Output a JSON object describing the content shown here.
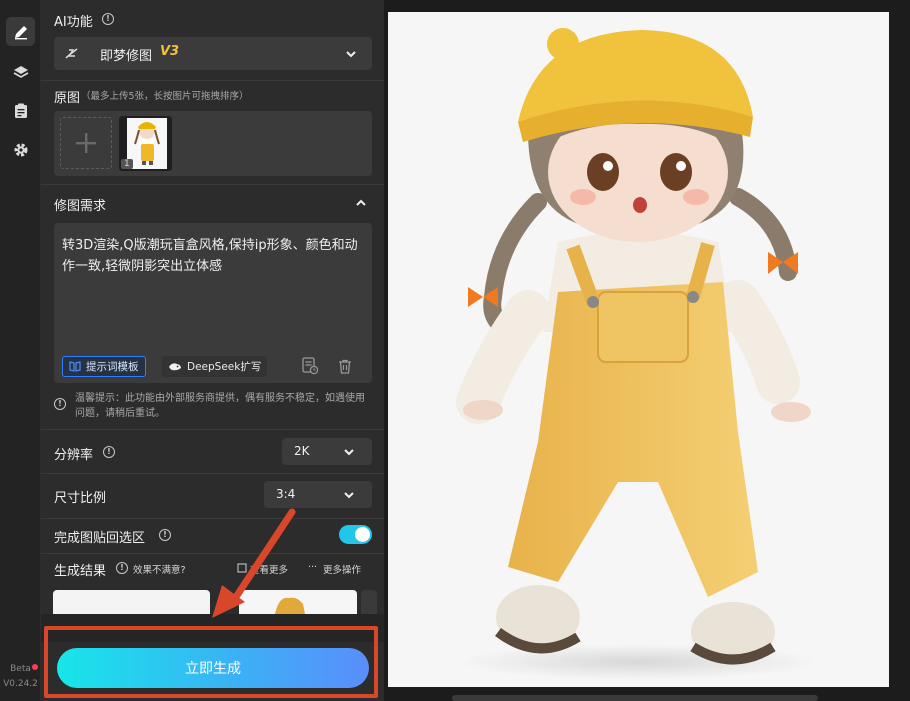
{
  "sidebar": {
    "items": [
      {
        "name": "edit",
        "icon": "pencil-icon",
        "active": true
      },
      {
        "name": "layers",
        "icon": "layers-icon",
        "active": false
      },
      {
        "name": "clipboard",
        "icon": "clipboard-icon",
        "active": false
      },
      {
        "name": "settings",
        "icon": "gear-icon",
        "active": false
      }
    ],
    "beta_label": "Beta",
    "version": "V0.24.2"
  },
  "panel": {
    "ai_function": {
      "label": "AI功能",
      "model_name": "即梦修图",
      "model_version": "V3"
    },
    "source": {
      "label": "原图",
      "hint": "（最多上传5张，长按图片可拖拽排序）",
      "thumb_index": "1"
    },
    "prompt": {
      "label": "修图需求",
      "text": "转3D渲染,Q版潮玩盲盒风格,保持ip形象、颜色和动作一致,轻微阴影突出立体感",
      "template_button": "提示词模板",
      "deepseek_button": "DeepSeek扩写"
    },
    "notice": "温馨提示：此功能由外部服务商提供，偶有服务不稳定，如遇使用问题，请稍后重试。",
    "resolution": {
      "label": "分辨率",
      "value": "2K"
    },
    "ratio": {
      "label": "尺寸比例",
      "value": "3:4"
    },
    "paste_back": {
      "label": "完成图贴回选区",
      "enabled": true
    },
    "results": {
      "label": "生成结果",
      "unsatisfied": "效果不满意?",
      "view_more": "查看更多",
      "more_actions": "更多操作"
    },
    "generate_button": "立即生成"
  },
  "colors": {
    "accent_cyan": "#17e6e9",
    "accent_blue": "#5a8dfc",
    "highlight": "#d9472a",
    "model_tag": "#f1c232"
  }
}
